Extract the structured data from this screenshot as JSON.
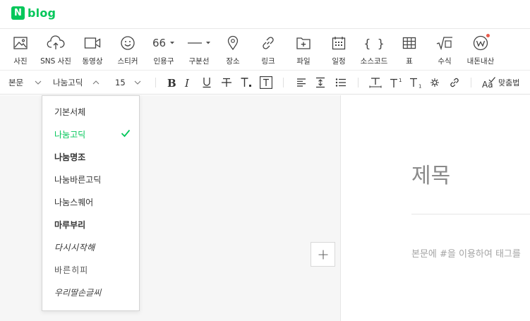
{
  "header": {
    "logo_letter": "N",
    "logo_text": "blog"
  },
  "toolbar": {
    "items": [
      {
        "label": "사진",
        "icon": "photo-icon"
      },
      {
        "label": "SNS 사진",
        "icon": "cloud-upload-icon"
      },
      {
        "label": "동영상",
        "icon": "video-icon"
      },
      {
        "label": "스티커",
        "icon": "smiley-icon"
      },
      {
        "label": "인용구",
        "icon": "quote-icon",
        "glyph": "66"
      },
      {
        "label": "구분선",
        "icon": "divider-icon"
      },
      {
        "label": "장소",
        "icon": "location-pin-icon"
      },
      {
        "label": "링크",
        "icon": "link-icon"
      },
      {
        "label": "파일",
        "icon": "file-icon"
      },
      {
        "label": "일정",
        "icon": "calendar-icon"
      },
      {
        "label": "소스코드",
        "icon": "code-braces-icon",
        "glyph": "{ }"
      },
      {
        "label": "표",
        "icon": "table-icon"
      },
      {
        "label": "수식",
        "icon": "formula-icon"
      },
      {
        "label": "내돈내산",
        "icon": "w-badge-icon"
      }
    ]
  },
  "format": {
    "paragraph_style": "본문",
    "font": "나눔고딕",
    "size": "15",
    "spellcheck": "맞춤법"
  },
  "font_menu": {
    "items": [
      "기본서체",
      "나눔고딕",
      "나눔명조",
      "나눔바른고딕",
      "나눔스퀘어",
      "마루부리",
      "다시시작해",
      "바른히피",
      "우리딸손글씨"
    ],
    "selected_index": 1
  },
  "editor": {
    "title_placeholder": "제목",
    "body_placeholder": "본문에 #을 이용하여 태그를"
  },
  "colors": {
    "brand": "#03c75a",
    "dot": "#e85b4c"
  }
}
